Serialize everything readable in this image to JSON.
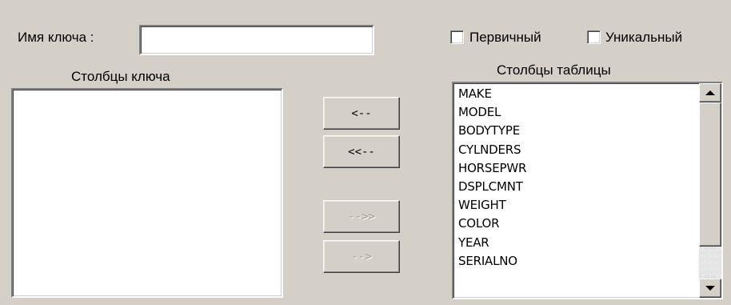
{
  "key_name": {
    "label": "Имя ключа :",
    "value": ""
  },
  "options": {
    "primary_label": "Первичный",
    "primary_checked": false,
    "unique_label": "Уникальный",
    "unique_checked": false
  },
  "key_columns": {
    "label": "Столбцы ключа",
    "items": []
  },
  "table_columns": {
    "label": "Столбцы таблицы",
    "items": [
      "MAKE",
      "MODEL",
      "BODYTYPE",
      "CYLNDERS",
      "HORSEPWR",
      "DSPLCMNT",
      "WEIGHT",
      "COLOR",
      "YEAR",
      "SERIALNO"
    ]
  },
  "buttons": {
    "remove_one": "<--",
    "remove_all": "<<--",
    "add_all": "-->>",
    "add_one": "-->"
  }
}
